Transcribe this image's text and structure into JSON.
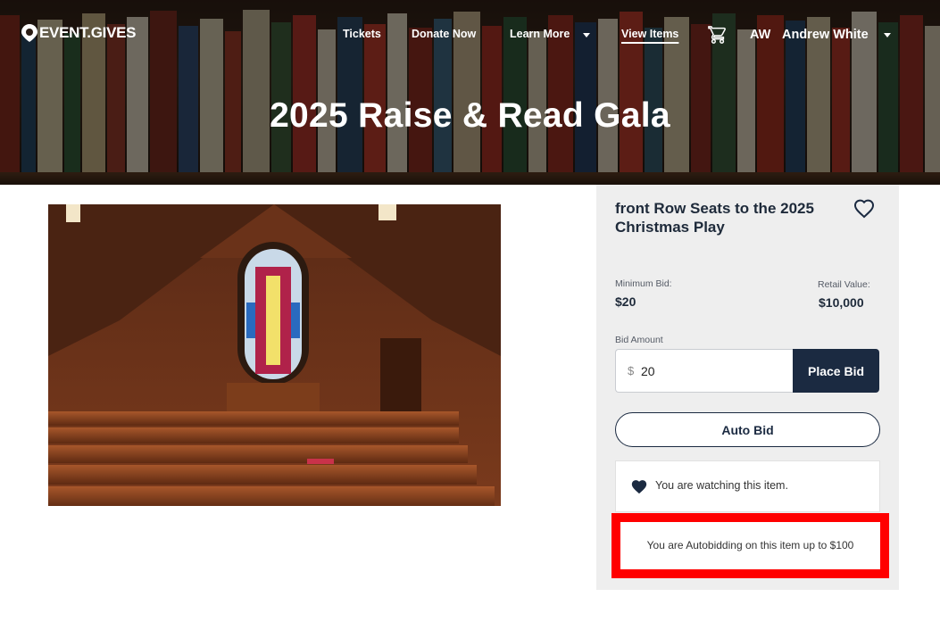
{
  "brand": {
    "logo_text": "EVENT.GIVES"
  },
  "nav": {
    "tickets": "Tickets",
    "donate": "Donate Now",
    "learn_more": "Learn More",
    "view_items": "View Items",
    "user_initials": "AW",
    "user_name": "Andrew White"
  },
  "event": {
    "title": "2025 Raise & Read Gala"
  },
  "item": {
    "title": "front Row Seats to the 2025 Christmas Play",
    "min_bid_label": "Minimum Bid:",
    "min_bid_value": "$20",
    "retail_label": "Retail Value:",
    "retail_value": "$10,000",
    "bid_amount_label": "Bid Amount",
    "currency_symbol": "$",
    "bid_amount_value": "20",
    "place_bid_label": "Place Bid",
    "auto_bid_label": "Auto Bid",
    "watching_text": "You are watching this item.",
    "autobid_text": "You are Autobidding on this item up to $100"
  },
  "colors": {
    "primary": "#1b2a41",
    "panel_bg": "#eeeeee",
    "highlight": "#ff0000"
  }
}
